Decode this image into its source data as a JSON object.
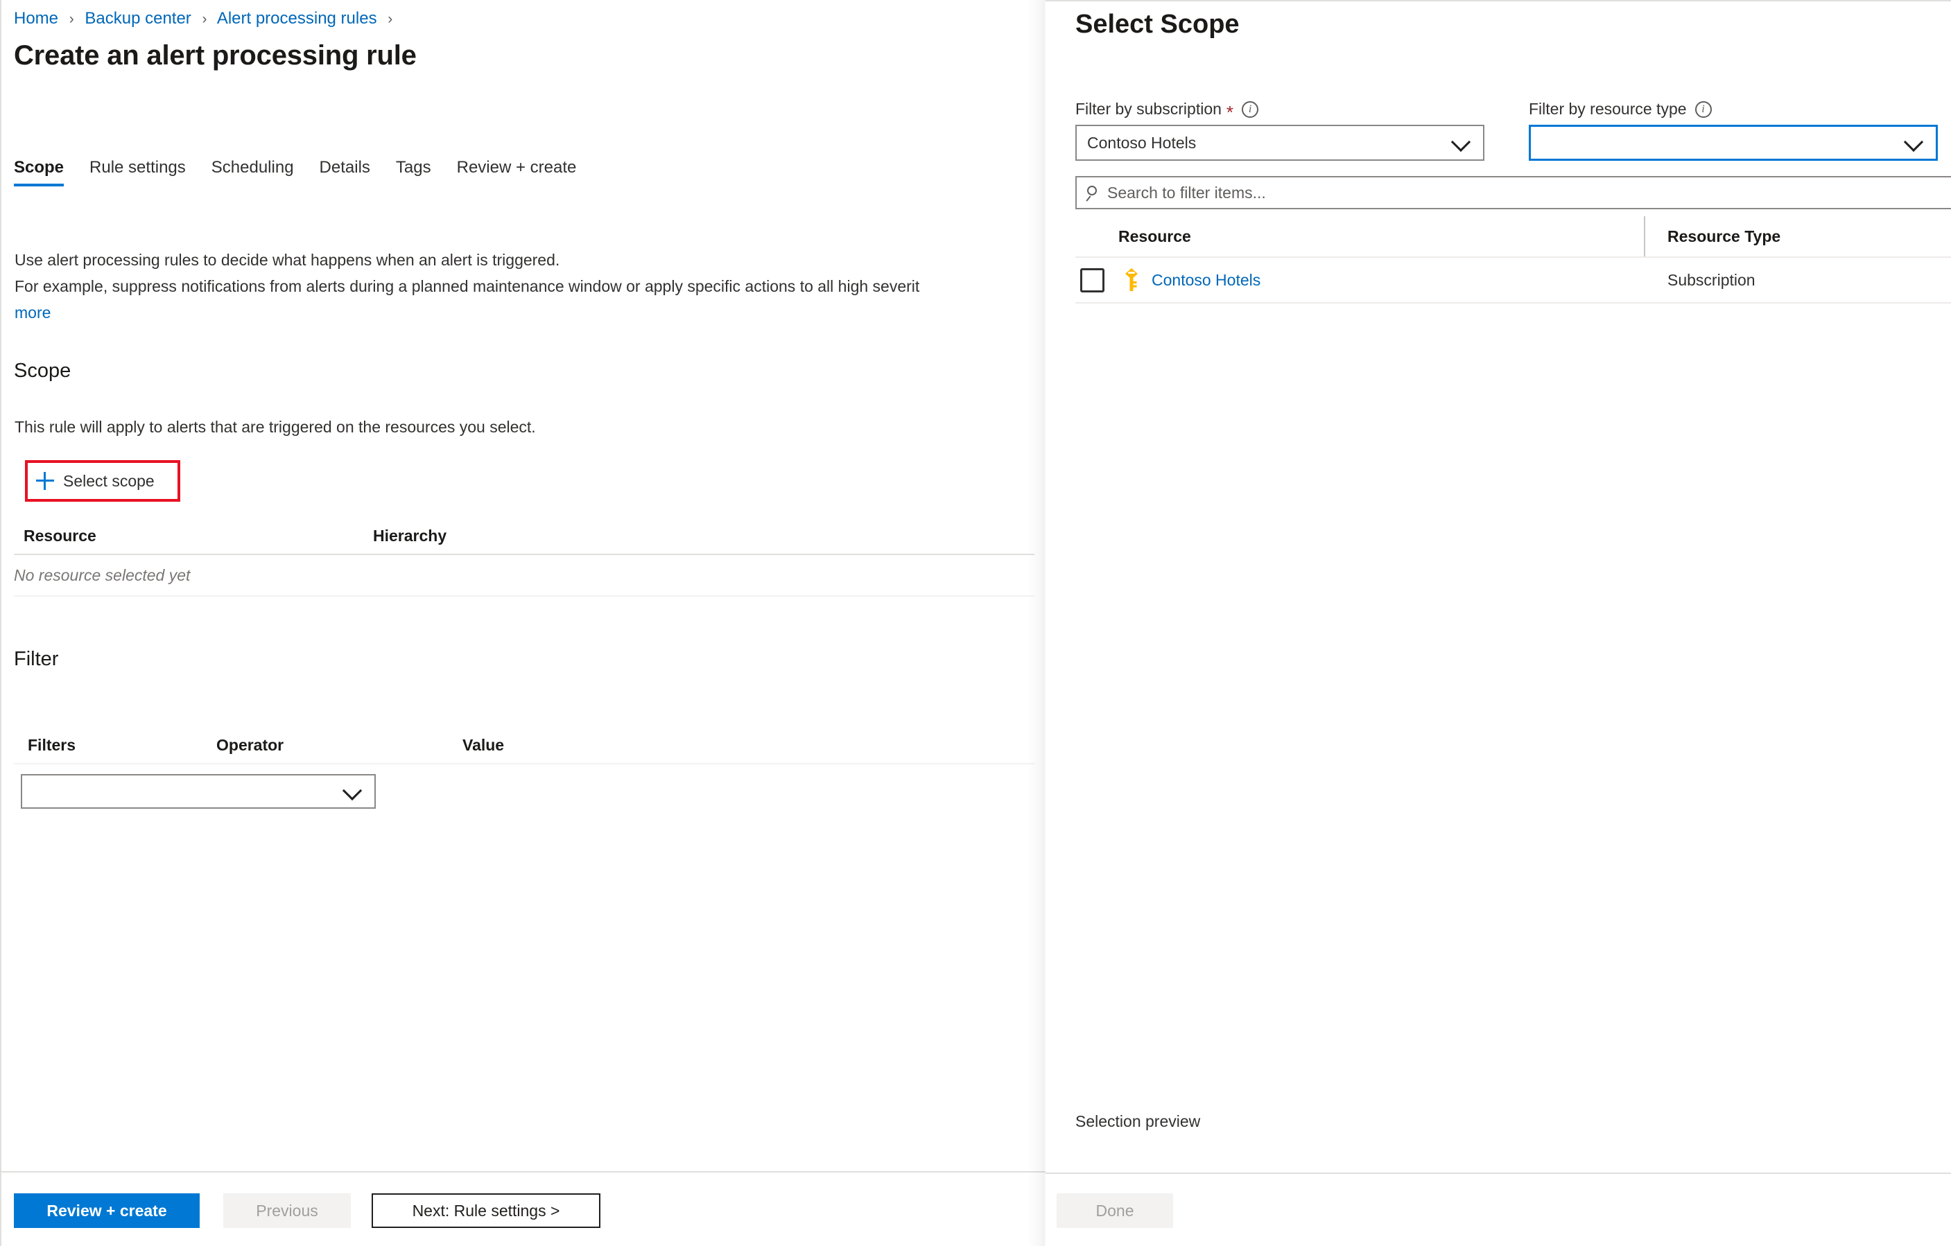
{
  "breadcrumb": {
    "items": [
      {
        "label": "Home"
      },
      {
        "label": "Backup center"
      },
      {
        "label": "Alert processing rules"
      }
    ],
    "separator": "›"
  },
  "page": {
    "title": "Create an alert processing rule"
  },
  "tabs": [
    {
      "label": "Scope",
      "active": true
    },
    {
      "label": "Rule settings",
      "active": false
    },
    {
      "label": "Scheduling",
      "active": false
    },
    {
      "label": "Details",
      "active": false
    },
    {
      "label": "Tags",
      "active": false
    },
    {
      "label": "Review + create",
      "active": false
    }
  ],
  "description": {
    "line1": "Use alert processing rules to decide what happens when an alert is triggered.",
    "line2": "For example, suppress notifications from alerts during a planned maintenance window or apply specific actions to all high severit",
    "more_link": "more"
  },
  "scope_section": {
    "heading": "Scope",
    "subtext": "This rule will apply to alerts that are triggered on the resources you select.",
    "select_scope_button": "Select scope",
    "columns": [
      "Resource",
      "Hierarchy"
    ],
    "empty_text": "No resource selected yet",
    "highlight_color": "#e81123"
  },
  "filter_section": {
    "heading": "Filter",
    "columns": [
      "Filters",
      "Operator",
      "Value"
    ],
    "filter_dropdown_value": ""
  },
  "footer": {
    "review_create": "Review + create",
    "previous": "Previous",
    "next": "Next: Rule settings >"
  },
  "select_scope_panel": {
    "title": "Select Scope",
    "subscription_filter": {
      "label": "Filter by subscription",
      "required": true,
      "required_mark": "*",
      "value": "Contoso Hotels"
    },
    "resource_type_filter": {
      "label": "Filter by resource type",
      "value": ""
    },
    "search": {
      "placeholder": "Search to filter items..."
    },
    "table": {
      "columns": [
        "Resource",
        "Resource Type"
      ],
      "rows": [
        {
          "checked": false,
          "icon": "key-icon",
          "resource": "Contoso Hotels",
          "resource_type": "Subscription"
        }
      ]
    },
    "selection_preview_label": "Selection preview",
    "done_button": "Done"
  },
  "colors": {
    "accent": "#0078d4",
    "link": "#0067b8",
    "highlight": "#e81123",
    "required": "#a4262c",
    "key_icon": "#ffb900"
  }
}
